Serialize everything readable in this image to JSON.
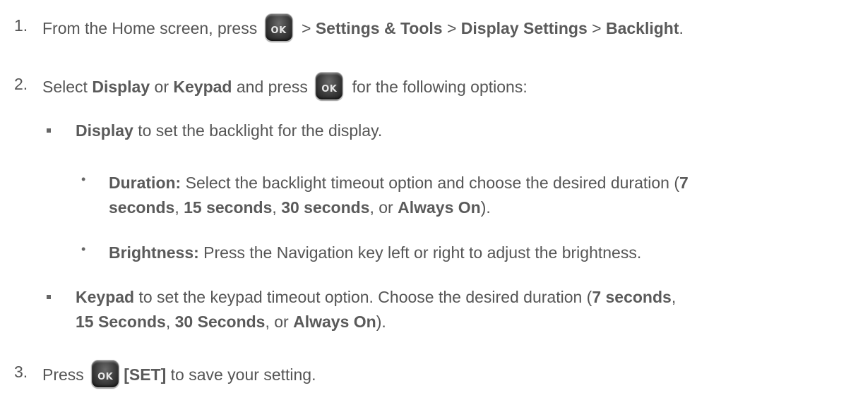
{
  "ok_label": "OK",
  "steps": [
    {
      "number": "1.",
      "text_before": "From the Home screen, press",
      "sep1": " > ",
      "b1": "Settings & Tools",
      "sep2": " > ",
      "b2": "Display Settings",
      "sep3": " > ",
      "b3": "Backlight",
      "end": "."
    },
    {
      "number": "2.",
      "t1": "Select ",
      "b1": "Display",
      "t2": " or ",
      "b2": "Keypad",
      "t3": " and press",
      "t4": " for the following options:"
    },
    {
      "number": "3.",
      "t1": "Press",
      "b1": "[SET]",
      "t2": " to save your setting."
    }
  ],
  "display_option": {
    "b1": "Display",
    "t1": " to set the backlight for the display."
  },
  "duration": {
    "b1": "Duration:",
    "t1": " Select the backlight timeout option and choose the desired duration (",
    "b2": "7",
    "b3": "seconds",
    "t2": ", ",
    "b4": "15 seconds",
    "t3": ", ",
    "b5": "30 seconds",
    "t4": ", or ",
    "b6": "Always On",
    "t5": ")."
  },
  "brightness": {
    "b1": "Brightness:",
    "t1": " Press the Navigation key left or right to adjust the brightness."
  },
  "keypad_option": {
    "b1": "Keypad",
    "t1": " to set the keypad timeout option. Choose the desired duration (",
    "b2": "7 seconds",
    "t2": ",",
    "b3": "15 Seconds",
    "t3": ", ",
    "b4": "30 Seconds",
    "t4": ", or ",
    "b5": "Always On",
    "t5": ")."
  }
}
